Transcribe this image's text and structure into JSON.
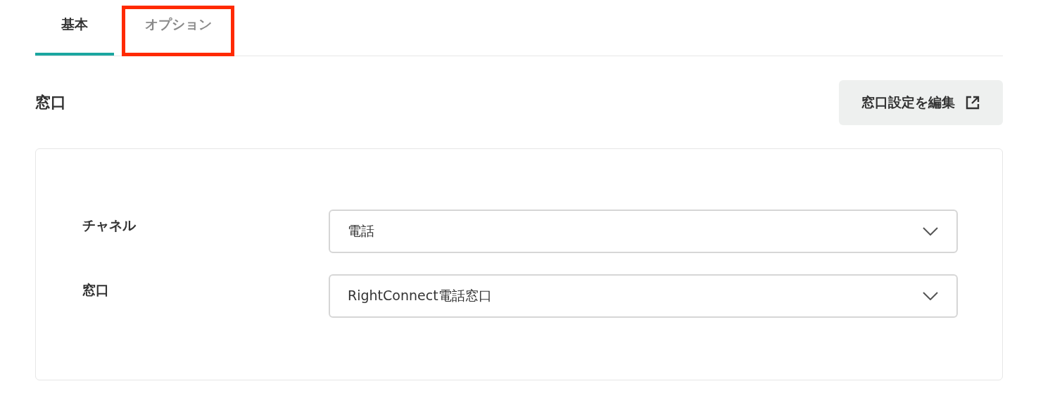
{
  "tabs": [
    {
      "label": "基本",
      "selected": true,
      "highlighted": false
    },
    {
      "label": "オプション",
      "selected": false,
      "highlighted": true
    }
  ],
  "section": {
    "title": "窓口",
    "edit_button": "窓口設定を編集"
  },
  "fields": [
    {
      "label": "チャネル",
      "value": "電話"
    },
    {
      "label": "窓口",
      "value": "RightConnect電話窓口"
    }
  ]
}
